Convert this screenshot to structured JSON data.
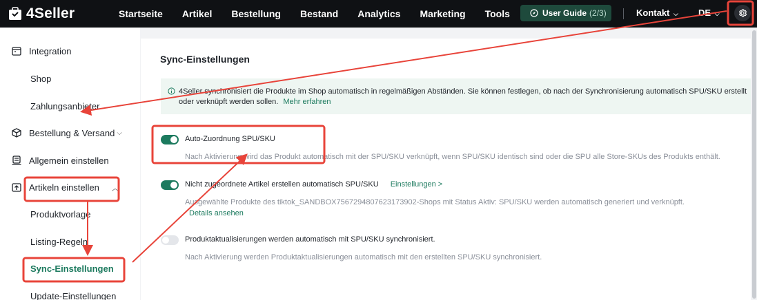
{
  "app": {
    "name": "4Seller"
  },
  "nav": {
    "items": [
      "Startseite",
      "Artikel",
      "Bestellung",
      "Bestand",
      "Analytics",
      "Marketing",
      "Tools"
    ],
    "guide_label": "User Guide",
    "guide_count": "(2/3)",
    "contact": "Kontakt",
    "language": "DE"
  },
  "sidebar": {
    "integration": "Integration",
    "shop": "Shop",
    "payment": "Zahlungsanbieter",
    "order_shipping": "Bestellung & Versand",
    "general": "Allgemein einstellen",
    "article": "Artikeln einstellen",
    "product_template": "Produktvorlage",
    "listing_rules": "Listing-Regeln",
    "sync": "Sync-Einstellungen",
    "update": "Update-Einstellungen"
  },
  "main": {
    "title": "Sync-Einstellungen",
    "info_text": "4Seller synchronisiert die Produkte im Shop automatisch in regelmäßigen Abständen. Sie können festlegen, ob nach der Synchronisierung automatisch SPU/SKU erstellt oder verknüpft werden sollen.",
    "info_link": "Mehr erfahren",
    "options": [
      {
        "title": "Auto-Zuordnung SPU/SKU",
        "desc": "Nach Aktivierung wird das Produkt automatisch mit der SPU/SKU verknüpft, wenn SPU/SKU identisch sind oder die SPU alle Store-SKUs des Produkts enthält.",
        "enabled": true
      },
      {
        "title": "Nicht zugeordnete Artikel erstellen automatisch SPU/SKU",
        "link": "Einstellungen >",
        "desc": "Ausgewählte Produkte des tiktok_SANDBOX7567294807623173902-Shops mit Status Aktiv: SPU/SKU werden automatisch generiert und verknüpft.",
        "desc_link": "Details ansehen",
        "enabled": true
      },
      {
        "title": "Produktaktualisierungen werden automatisch mit SPU/SKU synchronisiert.",
        "desc": "Nach Aktivierung werden Produktaktualisierungen automatisch mit den erstellten SPU/SKU synchronisiert.",
        "enabled": false
      }
    ]
  },
  "colors": {
    "accent": "#1c7a5e",
    "topbar": "#0f1114",
    "annotation": "#e8443a"
  }
}
